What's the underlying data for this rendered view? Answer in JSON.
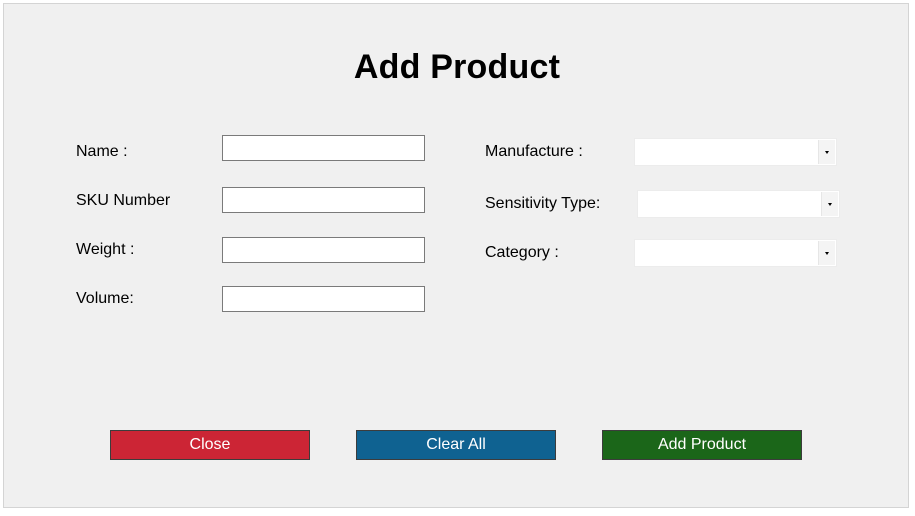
{
  "window": {
    "title": "Add Product"
  },
  "form": {
    "left_fields": [
      {
        "label": "Name :",
        "value": ""
      },
      {
        "label": "SKU Number",
        "value": ""
      },
      {
        "label": "Weight :",
        "value": ""
      },
      {
        "label": "Volume:",
        "value": ""
      }
    ],
    "right_fields": [
      {
        "label": "Manufacture :",
        "selected": ""
      },
      {
        "label": "Sensitivity Type:",
        "selected": ""
      },
      {
        "label": "Category :",
        "selected": ""
      }
    ]
  },
  "buttons": {
    "close_label": "Close",
    "clear_label": "Clear All",
    "add_label": "Add Product"
  },
  "colors": {
    "background": "#f0f0f0",
    "close_button": "#cc2535",
    "clear_button": "#0f6291",
    "add_button": "#1b6619"
  },
  "icons": {
    "combo_arrow": "chevron-down-icon"
  }
}
